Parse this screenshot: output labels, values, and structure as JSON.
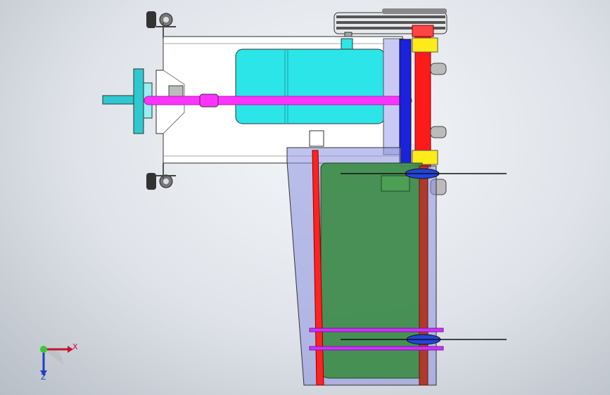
{
  "viewport": {
    "background_center": "#f4f6f9",
    "background_edge": "#b8bec6"
  },
  "model": {
    "parts": [
      {
        "name": "motor-body",
        "color": "#ffffff"
      },
      {
        "name": "motor-housing",
        "color": "#2ce5e8"
      },
      {
        "name": "shaft",
        "color": "#ff33ff"
      },
      {
        "name": "flange-disc",
        "color": "#2ec9cf"
      },
      {
        "name": "pulley-assembly",
        "color": "#a0a4a8"
      },
      {
        "name": "coupling",
        "color": "#ff1a1a"
      },
      {
        "name": "bearing-block",
        "color": "#ffeb1a"
      },
      {
        "name": "drive-plate",
        "color": "#1a22dd"
      },
      {
        "name": "tank",
        "color": "#3c8c45"
      },
      {
        "name": "frame-panel",
        "color": "#8b8fde"
      },
      {
        "name": "rod-left",
        "color": "#ff2222"
      },
      {
        "name": "rod-right",
        "color": "#b03a2a"
      },
      {
        "name": "clamp-bar",
        "color": "#cc33ff"
      },
      {
        "name": "leveling-foot",
        "color": "#333333"
      }
    ]
  },
  "triad": {
    "x_label": "X",
    "y_label": "Z",
    "x_color": "#c8102e",
    "y_color": "#1d3fbf",
    "origin_color": "#33cc33"
  }
}
